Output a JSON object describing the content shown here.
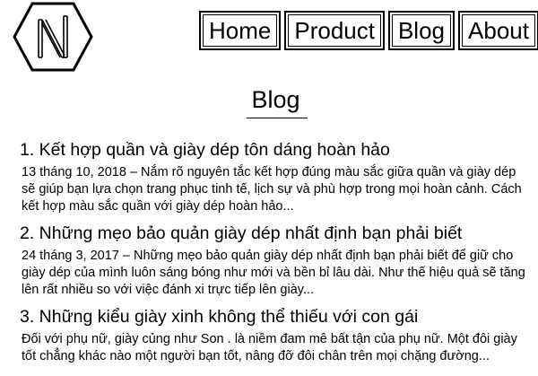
{
  "logo": {
    "icon": "hexagon-n-logo-icon"
  },
  "nav": {
    "items": [
      {
        "label": "Home"
      },
      {
        "label": "Product"
      },
      {
        "label": "Blog"
      },
      {
        "label": "About"
      }
    ]
  },
  "page": {
    "title": "Blog"
  },
  "posts": [
    {
      "title": "1. Kết hợp quần và giày dép tôn dáng hoàn hảo",
      "excerpt": "13 tháng 10, 2018 – Nắm rõ nguyên tắc kết hợp đúng màu sắc giữa quần và giày dép sẽ giúp bạn lựa chọn trang phục tinh tế, lịch sự và phù hợp trong mọi hoàn cảnh. Cách kết hợp màu sắc quần với giày dép hoàn hảo..."
    },
    {
      "title": "2. Những mẹo bảo quản giày dép nhất định bạn phải biết",
      "excerpt": "24 tháng 3, 2017 – Những mẹo bảo quản giày dép nhất định bạn phải biết để giữ cho giày dép của mình luôn sáng bóng như mới và bền bỉ lâu dài. Như thế hiệu quả sẽ tăng lên rất nhiều so với việc đánh xi trực tiếp lên giày..."
    },
    {
      "title": "3. Những kiểu giày xinh không thể thiếu với con gái",
      "excerpt": "Đối với phụ nữ, giày củng như Son . là niềm đam mê bất tận của phụ nữ. Một đôi giày tốt chẳng khác nào một người bạn tốt, nâng đỡ đôi chân trên mọi chặng đường..."
    }
  ]
}
